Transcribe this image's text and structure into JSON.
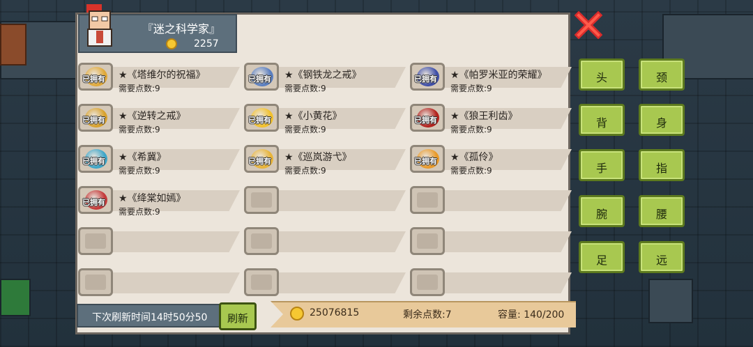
{
  "character": {
    "title": "『迷之科学家』",
    "gold": "2257"
  },
  "owned_label": "已拥有",
  "items": [
    {
      "name": "★《塔维尔的祝福》",
      "cost": "需要点数:9",
      "owned": true,
      "color": "#e0a93a"
    },
    {
      "name": "★《钢铁龙之戒》",
      "cost": "需要点数:9",
      "owned": true,
      "color": "#5b7fc0"
    },
    {
      "name": "★《帕罗米亚的荣耀》",
      "cost": "需要点数:9",
      "owned": true,
      "color": "#3f4fa8"
    },
    {
      "name": "★《逆转之戒》",
      "cost": "需要点数:9",
      "owned": true,
      "color": "#d8a22e"
    },
    {
      "name": "★《小黄花》",
      "cost": "需要点数:9",
      "owned": true,
      "color": "#f2c12e"
    },
    {
      "name": "★《狼王利齿》",
      "cost": "需要点数:9",
      "owned": true,
      "color": "#b3241f"
    },
    {
      "name": "★《希冀》",
      "cost": "需要点数:9",
      "owned": true,
      "color": "#3fa6c8"
    },
    {
      "name": "★《巡岚游弋》",
      "cost": "需要点数:9",
      "owned": true,
      "color": "#e8b43a"
    },
    {
      "name": "★《孤伶》",
      "cost": "需要点数:9",
      "owned": true,
      "color": "#e99a2a"
    },
    {
      "name": "★《绛棠如嫣》",
      "cost": "需要点数:9",
      "owned": true,
      "color": "#c43b3b"
    },
    {
      "name": "",
      "cost": "",
      "owned": false
    },
    {
      "name": "",
      "cost": "",
      "owned": false
    },
    {
      "name": "",
      "cost": "",
      "owned": false
    },
    {
      "name": "",
      "cost": "",
      "owned": false
    },
    {
      "name": "",
      "cost": "",
      "owned": false
    },
    {
      "name": "",
      "cost": "",
      "owned": false
    },
    {
      "name": "",
      "cost": "",
      "owned": false
    },
    {
      "name": "",
      "cost": "",
      "owned": false
    }
  ],
  "categories": [
    "头",
    "颈",
    "背",
    "身",
    "手",
    "指",
    "腕",
    "腰",
    "足",
    "远"
  ],
  "footer": {
    "refresh_time": "下次刷新时间14时50分50",
    "refresh_button": "刷新",
    "coins": "25076815",
    "remaining_points": "剩余点数:7",
    "capacity": "容量:  140/200"
  },
  "colors": {
    "accent_green": "#a8c850",
    "panel": "#ece5db",
    "close_red": "#d92b2b"
  }
}
